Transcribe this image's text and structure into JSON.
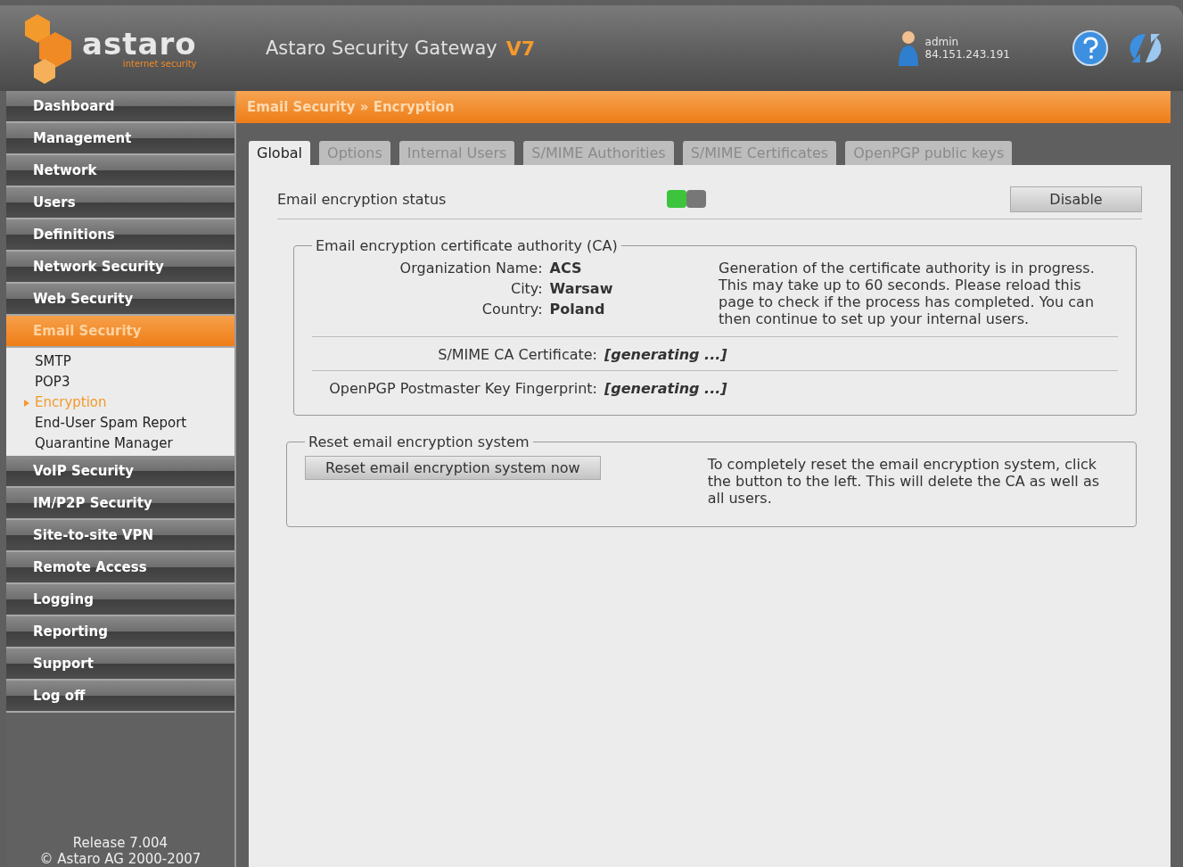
{
  "header": {
    "logo": "astaro",
    "logo_tagline": "internet security",
    "title": "Astaro Security Gateway",
    "version": "V7",
    "user": "admin",
    "ip": "84.151.243.191"
  },
  "sidebar": {
    "items": [
      {
        "label": "Dashboard",
        "selected": false
      },
      {
        "label": "Management",
        "selected": false
      },
      {
        "label": "Network",
        "selected": false
      },
      {
        "label": "Users",
        "selected": false
      },
      {
        "label": "Definitions",
        "selected": false
      },
      {
        "label": "Network Security",
        "selected": false
      },
      {
        "label": "Web Security",
        "selected": false
      },
      {
        "label": "Email Security",
        "selected": true,
        "children": [
          {
            "label": "SMTP",
            "selected": false
          },
          {
            "label": "POP3",
            "selected": false
          },
          {
            "label": "Encryption",
            "selected": true
          },
          {
            "label": "End-User Spam Report",
            "selected": false
          },
          {
            "label": "Quarantine Manager",
            "selected": false
          }
        ]
      },
      {
        "label": "VoIP Security",
        "selected": false
      },
      {
        "label": "IM/P2P Security",
        "selected": false
      },
      {
        "label": "Site-to-site VPN",
        "selected": false
      },
      {
        "label": "Remote Access",
        "selected": false
      },
      {
        "label": "Logging",
        "selected": false
      },
      {
        "label": "Reporting",
        "selected": false
      },
      {
        "label": "Support",
        "selected": false
      },
      {
        "label": "Log off",
        "selected": false
      }
    ],
    "release": "Release 7.004",
    "copyright": "© Astaro AG 2000-2007"
  },
  "breadcrumb": "Email Security » Encryption",
  "tabs": [
    {
      "label": "Global",
      "selected": true
    },
    {
      "label": "Options",
      "selected": false
    },
    {
      "label": "Internal Users",
      "selected": false
    },
    {
      "label": "S/MIME Authorities",
      "selected": false
    },
    {
      "label": "S/MIME Certificates",
      "selected": false
    },
    {
      "label": "OpenPGP public keys",
      "selected": false
    }
  ],
  "status": {
    "label": "Email encryption status",
    "on": true,
    "button": "Disable"
  },
  "ca": {
    "legend": "Email encryption certificate authority (CA)",
    "fields": [
      {
        "label": "Organization Name:",
        "value": "ACS"
      },
      {
        "label": "City:",
        "value": "Warsaw"
      },
      {
        "label": "Country:",
        "value": "Poland"
      }
    ],
    "note": "Generation of the certificate authority is in progress. This may take up to 60 seconds. Please reload this page to check if the process has completed. You can then continue to set up your internal users.",
    "rows": [
      {
        "label": "S/MIME CA Certificate:",
        "value": "[generating ...]"
      },
      {
        "label": "OpenPGP Postmaster Key Fingerprint:",
        "value": "[generating ...]"
      }
    ]
  },
  "reset": {
    "legend": "Reset email encryption system",
    "button": "Reset email encryption system now",
    "note": "To completely reset the email encryption system, click the button to the left. This will delete the CA as well as all users."
  }
}
